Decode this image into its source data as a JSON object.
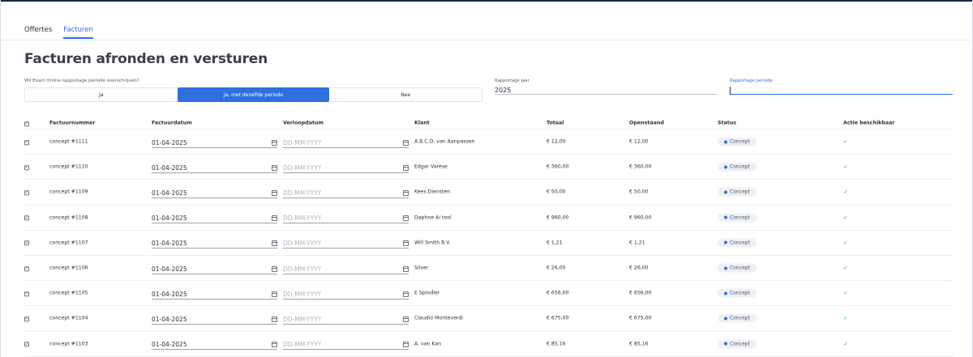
{
  "tabs": [
    {
      "label": "Offertes",
      "active": false
    },
    {
      "label": "Facturen",
      "active": true
    }
  ],
  "page_title": "Facturen afronden en versturen",
  "override_question": "Wil Exact Online rapportage periode overschrijven?",
  "override_options": [
    {
      "label": "Ja",
      "selected": false
    },
    {
      "label": "Ja, met dezelfde periode",
      "selected": true
    },
    {
      "label": "Nee",
      "selected": false
    }
  ],
  "rapportage_jaar": {
    "label": "Rapportage jaar",
    "value": "2025"
  },
  "rapportage_periode": {
    "label": "Rapportage periode",
    "value": ""
  },
  "table": {
    "columns": [
      "Factuurnummer",
      "Factuurdatum",
      "Verloopdatum",
      "Klant",
      "Totaal",
      "Openstaand",
      "Status",
      "Actie beschikbaar"
    ],
    "date_placeholder": "DD-MM-YYYY",
    "rows": [
      {
        "nr": "concept #1111",
        "factuurdatum": "01-04-2025",
        "verloopdatum": "",
        "klant": "A.B.C.D. van Aanpassen",
        "totaal": "€ 12,00",
        "openstaand": "€ 12,00",
        "status": "Concept"
      },
      {
        "nr": "concept #1110",
        "factuurdatum": "01-04-2025",
        "verloopdatum": "",
        "klant": "Edgar Varèse",
        "totaal": "€ 360,00",
        "openstaand": "€ 360,00",
        "status": "Concept"
      },
      {
        "nr": "concept #1109",
        "factuurdatum": "01-04-2025",
        "verloopdatum": "",
        "klant": "Kees Diensten",
        "totaal": "€ 50,00",
        "openstaand": "€ 50,00",
        "status": "Concept"
      },
      {
        "nr": "concept #1108",
        "factuurdatum": "01-04-2025",
        "verloopdatum": "",
        "klant": "Daphne Ai tool",
        "totaal": "€ 960,00",
        "openstaand": "€ 960,00",
        "status": "Concept"
      },
      {
        "nr": "concept #1107",
        "factuurdatum": "01-04-2025",
        "verloopdatum": "",
        "klant": "Will Smith B.V.",
        "totaal": "€ 1,21",
        "openstaand": "€ 1,21",
        "status": "Concept"
      },
      {
        "nr": "concept #1106",
        "factuurdatum": "01-04-2025",
        "verloopdatum": "",
        "klant": "Silver",
        "totaal": "€ 26,00",
        "openstaand": "€ 26,00",
        "status": "Concept"
      },
      {
        "nr": "concept #1105",
        "factuurdatum": "01-04-2025",
        "verloopdatum": "",
        "klant": "E Spindler",
        "totaal": "€ 656,00",
        "openstaand": "€ 656,00",
        "status": "Concept"
      },
      {
        "nr": "concept #1104",
        "factuurdatum": "01-04-2025",
        "verloopdatum": "",
        "klant": "Claudio Monteverdi",
        "totaal": "€ 675,00",
        "openstaand": "€ 675,00",
        "status": "Concept"
      },
      {
        "nr": "concept #1103",
        "factuurdatum": "01-04-2025",
        "verloopdatum": "",
        "klant": "A. van Kan",
        "totaal": "€ 85,16",
        "openstaand": "€ 85,16",
        "status": "Concept"
      }
    ]
  },
  "colors": {
    "accent": "#2f6fe0",
    "check": "#34b37a"
  }
}
